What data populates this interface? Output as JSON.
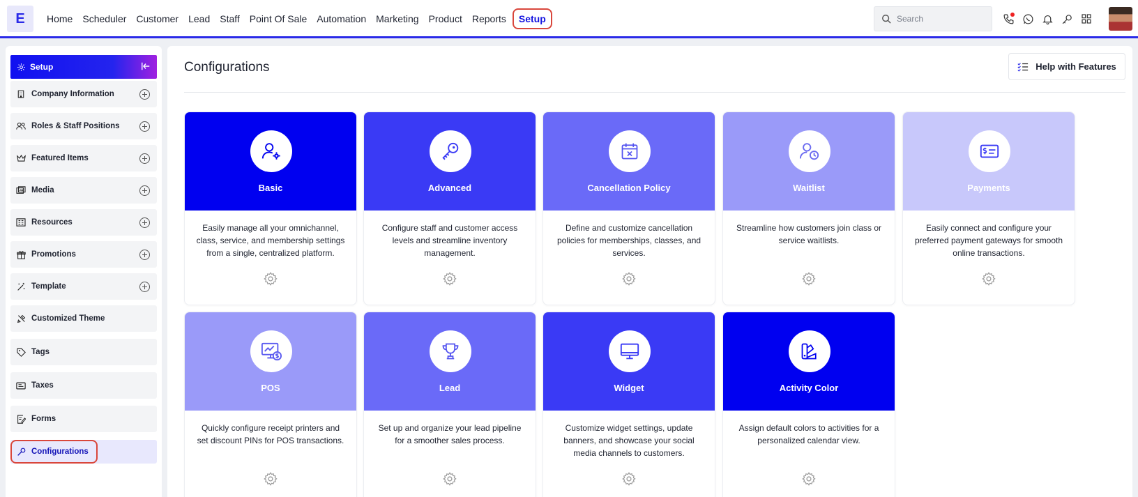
{
  "app": {
    "logo_letter": "E"
  },
  "nav": {
    "items": [
      "Home",
      "Scheduler",
      "Customer",
      "Lead",
      "Staff",
      "Point Of Sale",
      "Automation",
      "Marketing",
      "Product",
      "Reports"
    ],
    "active": "Setup"
  },
  "search": {
    "placeholder": "Search"
  },
  "top_icons": [
    "phone-icon",
    "whatsapp-icon",
    "bell-icon",
    "key-icon",
    "grid-icon"
  ],
  "sidebar": {
    "header": "Setup",
    "items": [
      {
        "label": "Company Information",
        "icon": "building-icon",
        "expandable": true
      },
      {
        "label": "Roles & Staff Positions",
        "icon": "users-icon",
        "expandable": true
      },
      {
        "label": "Featured Items",
        "icon": "crown-icon",
        "expandable": true
      },
      {
        "label": "Media",
        "icon": "media-icon",
        "expandable": true
      },
      {
        "label": "Resources",
        "icon": "resources-icon",
        "expandable": true
      },
      {
        "label": "Promotions",
        "icon": "gift-icon",
        "expandable": true
      },
      {
        "label": "Template",
        "icon": "wand-icon",
        "expandable": true
      },
      {
        "label": "Customized Theme",
        "icon": "brush-icon",
        "expandable": false
      },
      {
        "label": "Tags",
        "icon": "tag-icon",
        "expandable": false
      },
      {
        "label": "Taxes",
        "icon": "tax-icon",
        "expandable": false
      },
      {
        "label": "Forms",
        "icon": "form-icon",
        "expandable": false
      },
      {
        "label": "Configurations",
        "icon": "wrench-icon",
        "expandable": false,
        "active": true
      }
    ]
  },
  "main": {
    "title": "Configurations",
    "help_button": "Help with Features",
    "cards": [
      {
        "title": "Basic",
        "icon": "user-gear-icon",
        "shade": "c0",
        "description": "Easily manage all your omnichannel, class, service, and membership settings from a single, centralized platform."
      },
      {
        "title": "Advanced",
        "icon": "key-icon",
        "shade": "c1",
        "description": "Configure staff and customer access levels and streamline inventory management."
      },
      {
        "title": "Cancellation Policy",
        "icon": "calendar-x-icon",
        "shade": "c2",
        "description": "Define and customize cancellation policies for memberships, classes, and services."
      },
      {
        "title": "Waitlist",
        "icon": "user-clock-icon",
        "shade": "c3",
        "description": "Streamline how customers join class or service waitlists."
      },
      {
        "title": "Payments",
        "icon": "payment-card-icon",
        "shade": "c4",
        "description": "Easily connect and configure your preferred payment gateways for smooth online transactions."
      },
      {
        "title": "POS",
        "icon": "monitor-dollar-icon",
        "shade": "c3",
        "description": "Quickly configure receipt printers and set discount PINs for POS transactions."
      },
      {
        "title": "Lead",
        "icon": "trophy-icon",
        "shade": "c2",
        "description": "Set up and organize your lead pipeline for a smoother sales process."
      },
      {
        "title": "Widget",
        "icon": "monitor-icon",
        "shade": "c1",
        "description": "Customize widget settings, update banners, and showcase your social media channels to customers."
      },
      {
        "title": "Activity Color",
        "icon": "palette-icon",
        "shade": "c0",
        "description": "Assign default colors to activities for a personalized calendar view."
      }
    ]
  },
  "colors": {
    "accent": "#2a2ae8",
    "highlight": "#d9473c",
    "active_bg": "#e8e8fd"
  }
}
